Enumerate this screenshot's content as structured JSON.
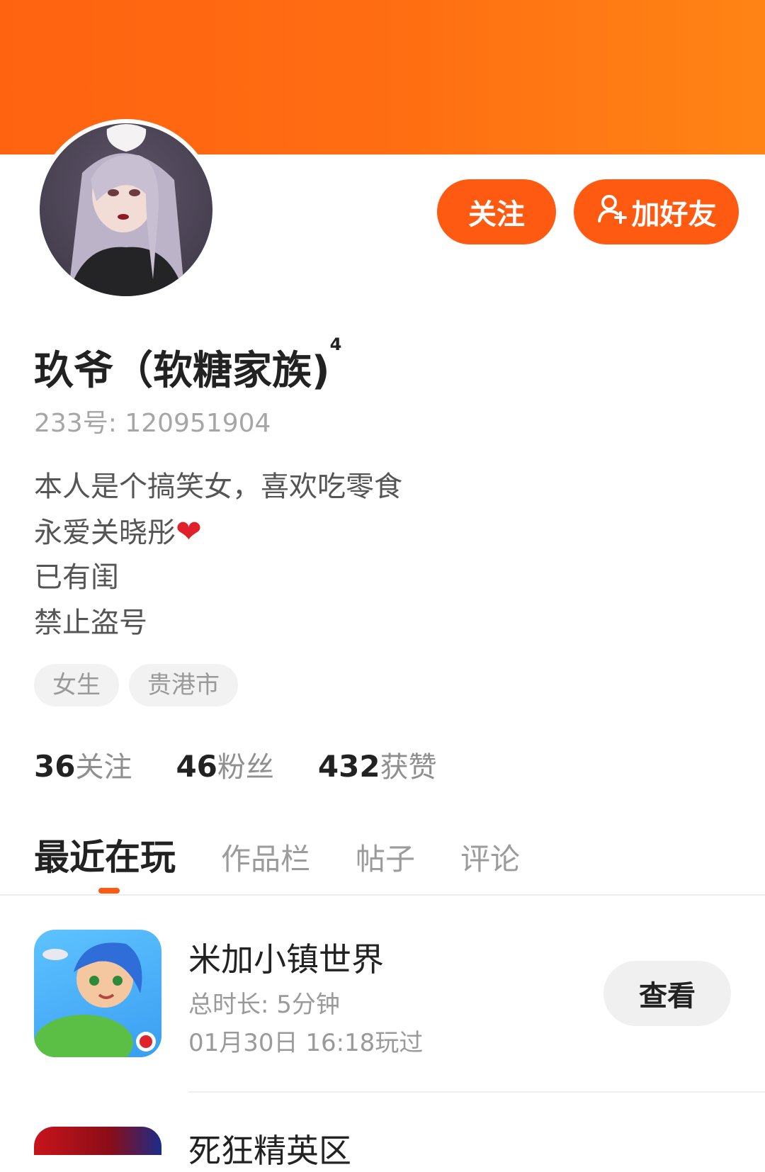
{
  "profile": {
    "name": "玖爷（软糖家族)",
    "level": "4",
    "uid_label": "233号:",
    "uid": "120951904",
    "bio": [
      "本人是个搞笑女，喜欢吃零食",
      "永爱关晓彤",
      "已有闺",
      "禁止盗号"
    ],
    "bio_emoji": "❤",
    "tags": [
      "女生",
      "贵港市"
    ],
    "stats": [
      {
        "num": "36",
        "label": "关注"
      },
      {
        "num": "46",
        "label": "粉丝"
      },
      {
        "num": "432",
        "label": "获赞"
      }
    ]
  },
  "actions": {
    "follow_label": "关注",
    "add_friend_label": "加好友",
    "add_friend_icon": "add-user-icon"
  },
  "tabs": [
    "最近在玩",
    "作品栏",
    "帖子",
    "评论"
  ],
  "recent_games": [
    {
      "title": "米加小镇世界",
      "duration": "总时长: 5分钟",
      "played": "01月30日 16:18玩过",
      "button": "查看"
    },
    {
      "title": "死狂精英区"
    }
  ],
  "colors": {
    "brand": "#ff5a12",
    "banner_start": "#ff6310",
    "banner_end": "#ff8415"
  }
}
